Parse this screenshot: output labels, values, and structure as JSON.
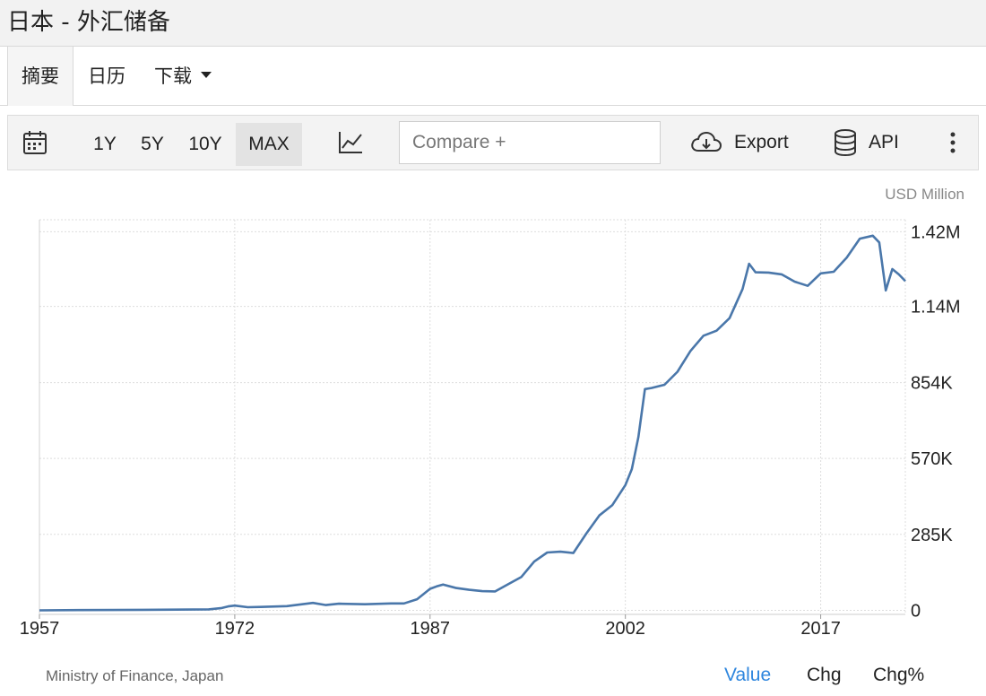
{
  "page": {
    "title": "日本 - 外汇储备"
  },
  "tabs": [
    {
      "label": "摘要",
      "active": true
    },
    {
      "label": "日历",
      "active": false
    },
    {
      "label": "下载",
      "active": false
    }
  ],
  "toolbar": {
    "ranges": [
      {
        "label": "1Y",
        "active": false
      },
      {
        "label": "5Y",
        "active": false
      },
      {
        "label": "10Y",
        "active": false
      },
      {
        "label": "MAX",
        "active": true
      }
    ],
    "compare_placeholder": "Compare +",
    "export_label": "Export",
    "api_label": "API",
    "icons": [
      "calendar-icon",
      "line-chart-icon",
      "cloud-download-icon",
      "database-icon",
      "more-vertical-icon"
    ]
  },
  "chart_data": {
    "type": "line",
    "title": "",
    "xlabel": "",
    "ylabel": "",
    "unit": "USD Million",
    "source": "Ministry of Finance, Japan",
    "grid": true,
    "line_color": "#4a77aa",
    "xlim": [
      1957,
      2023.5
    ],
    "ylim": [
      -15000,
      1465000
    ],
    "x_ticks": [
      {
        "value": 1957,
        "label": "1957"
      },
      {
        "value": 1972,
        "label": "1972"
      },
      {
        "value": 1987,
        "label": "1987"
      },
      {
        "value": 2002,
        "label": "2002"
      },
      {
        "value": 2017,
        "label": "2017"
      }
    ],
    "y_ticks": [
      {
        "value": 0,
        "label": "0"
      },
      {
        "value": 285000,
        "label": "285K"
      },
      {
        "value": 570000,
        "label": "570K"
      },
      {
        "value": 854000,
        "label": "854K"
      },
      {
        "value": 1140000,
        "label": "1.14M"
      },
      {
        "value": 1420000,
        "label": "1.42M"
      }
    ],
    "series": [
      {
        "x": [
          1957,
          1960,
          1965,
          1970,
          1971,
          1971.5,
          1972,
          1973,
          1974,
          1976,
          1978,
          1979,
          1980,
          1982,
          1984,
          1985,
          1986,
          1987,
          1987.5,
          1988,
          1989,
          1990,
          1991,
          1992,
          1993,
          1994,
          1995,
          1996,
          1997,
          1998,
          1999,
          2000,
          2001,
          2002,
          2002.5,
          2003,
          2003.5,
          2004,
          2005,
          2006,
          2007,
          2008,
          2009,
          2010,
          2011,
          2011.5,
          2012,
          2013,
          2014,
          2015,
          2016,
          2017,
          2018,
          2019,
          2020,
          2021,
          2021.5,
          2022,
          2022.5,
          2023,
          2023.5
        ],
        "values": [
          0,
          1000,
          2000,
          4000,
          9000,
          15000,
          18000,
          12000,
          13000,
          16000,
          28000,
          20000,
          25000,
          23000,
          26000,
          26000,
          42000,
          81000,
          90000,
          97000,
          84000,
          77000,
          72000,
          71000,
          98000,
          125000,
          183000,
          217000,
          220000,
          215000,
          288000,
          356000,
          395000,
          470000,
          530000,
          650000,
          830000,
          834000,
          846000,
          895000,
          973000,
          1030000,
          1049000,
          1096000,
          1205000,
          1300000,
          1268000,
          1267000,
          1260000,
          1233000,
          1217000,
          1264000,
          1270000,
          1323000,
          1394000,
          1405000,
          1380000,
          1200000,
          1280000,
          1260000,
          1235000
        ]
      }
    ]
  },
  "footer": {
    "modes": [
      {
        "label": "Value",
        "active": true
      },
      {
        "label": "Chg",
        "active": false
      },
      {
        "label": "Chg%",
        "active": false
      }
    ]
  }
}
